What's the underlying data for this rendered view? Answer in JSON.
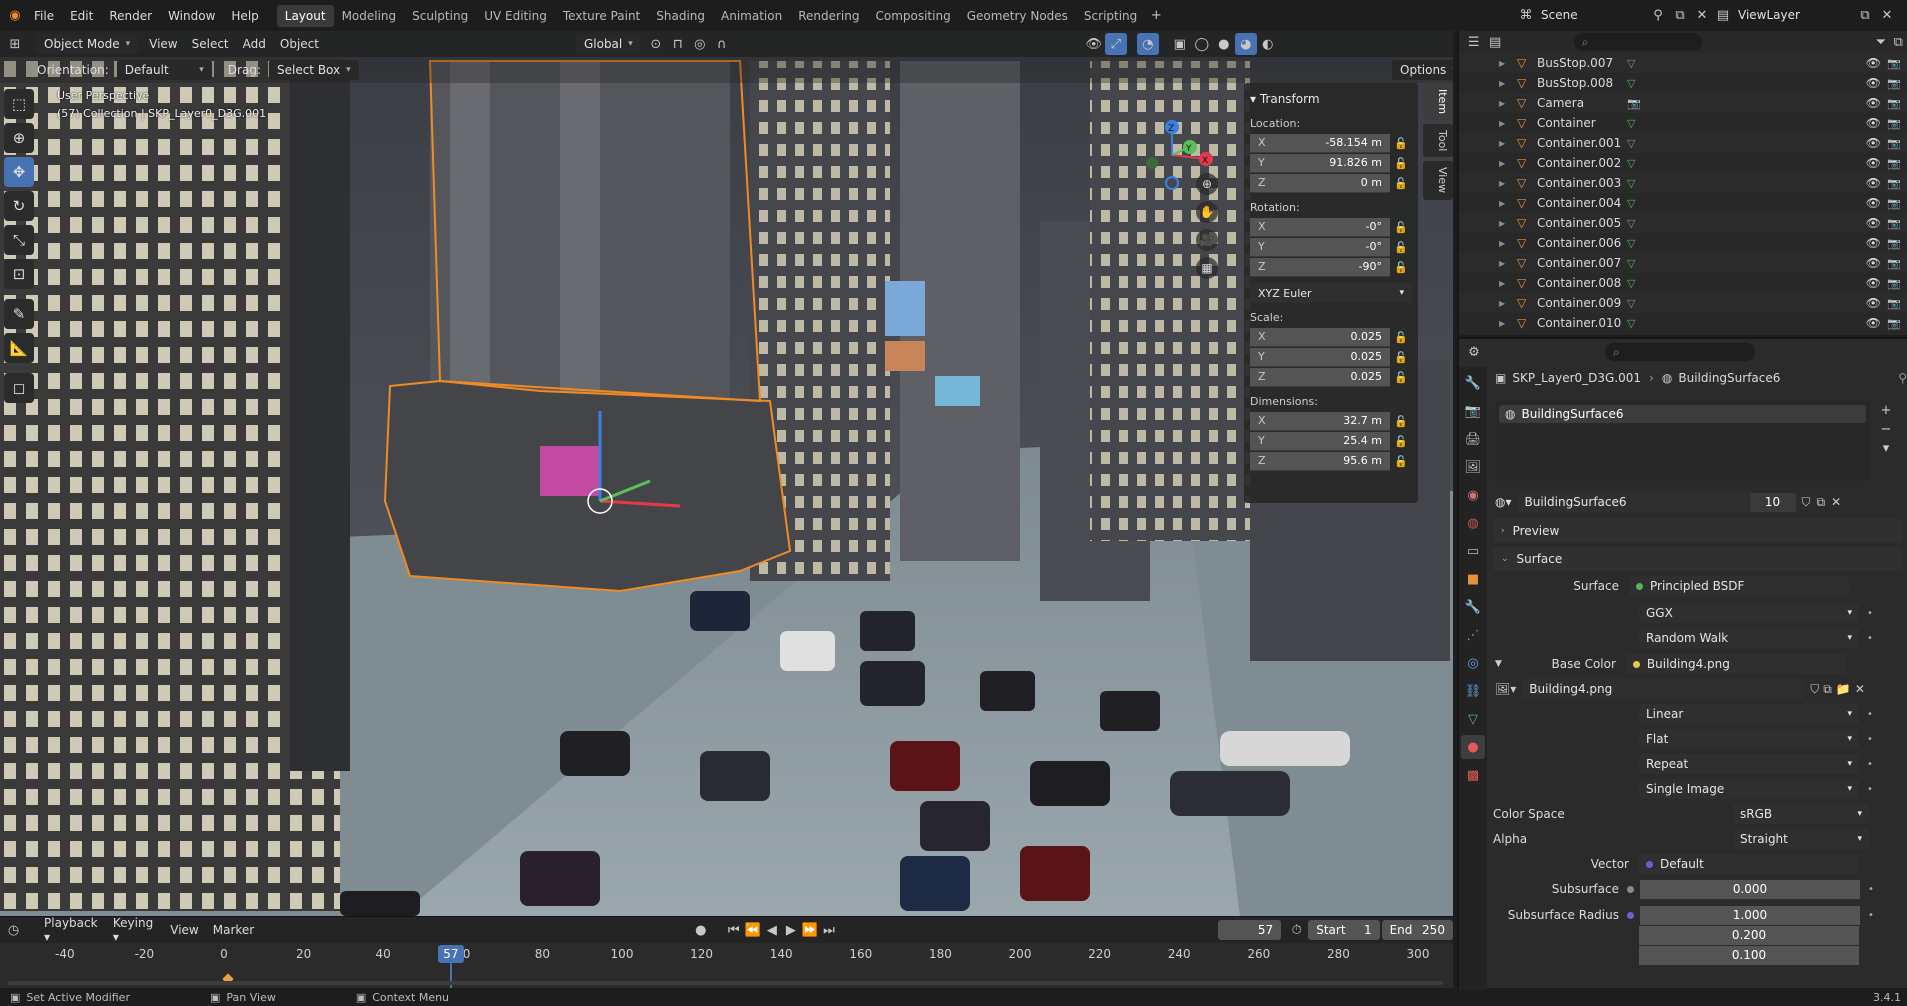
{
  "menu": {
    "file": "File",
    "edit": "Edit",
    "render": "Render",
    "window": "Window",
    "help": "Help"
  },
  "workspaces": [
    "Layout",
    "Modeling",
    "Sculpting",
    "UV Editing",
    "Texture Paint",
    "Shading",
    "Animation",
    "Rendering",
    "Compositing",
    "Geometry Nodes",
    "Scripting"
  ],
  "workspace_add": "+",
  "scene": {
    "label": "Scene",
    "view_layer": "ViewLayer"
  },
  "viewport": {
    "mode": "Object Mode",
    "menus": [
      "View",
      "Select",
      "Add",
      "Object"
    ],
    "transform_orientation": "Global",
    "orientation_label": "Orientation:",
    "orientation_value": "Default",
    "drag_label": "Drag:",
    "drag_value": "Select Box",
    "options_label": "Options",
    "overlay_line1": "User Perspective",
    "overlay_line2": "(57) Collection | SKP_Layer0_D3G.001"
  },
  "npanel": {
    "tabs": [
      "Item",
      "Tool",
      "View"
    ],
    "header": "Transform",
    "location_label": "Location:",
    "location": [
      {
        "axis": "X",
        "value": "-58.154 m"
      },
      {
        "axis": "Y",
        "value": "91.826 m"
      },
      {
        "axis": "Z",
        "value": "0 m"
      }
    ],
    "rotation_label": "Rotation:",
    "rotation": [
      {
        "axis": "X",
        "value": "-0°"
      },
      {
        "axis": "Y",
        "value": "-0°"
      },
      {
        "axis": "Z",
        "value": "-90°"
      }
    ],
    "rotation_mode": "XYZ Euler",
    "scale_label": "Scale:",
    "scale": [
      {
        "axis": "X",
        "value": "0.025"
      },
      {
        "axis": "Y",
        "value": "0.025"
      },
      {
        "axis": "Z",
        "value": "0.025"
      }
    ],
    "dimensions_label": "Dimensions:",
    "dimensions": [
      {
        "axis": "X",
        "value": "32.7 m"
      },
      {
        "axis": "Y",
        "value": "25.4 m"
      },
      {
        "axis": "Z",
        "value": "95.6 m"
      }
    ]
  },
  "gizmo": {
    "x": "X",
    "y": "Y",
    "z": "Z"
  },
  "timeline": {
    "menus": [
      "Playback",
      "Keying",
      "View",
      "Marker"
    ],
    "current_frame": "57",
    "start_label": "Start",
    "start": "1",
    "end_label": "End",
    "end": "250",
    "ticks": [
      "-40",
      "-20",
      "0",
      "20",
      "40",
      "60",
      "80",
      "100",
      "120",
      "140",
      "160",
      "180",
      "200",
      "220",
      "240",
      "260",
      "280",
      "300"
    ],
    "indicator": "57"
  },
  "statusbar": {
    "items": [
      "Set Active Modifier",
      "Pan View",
      "Context Menu"
    ],
    "version": "3.4.1"
  },
  "outliner": {
    "rows": [
      {
        "name": "BusStop.007",
        "kind": "mesh"
      },
      {
        "name": "BusStop.008",
        "kind": "mesh"
      },
      {
        "name": "Camera",
        "kind": "camera"
      },
      {
        "name": "Container",
        "kind": "mesh"
      },
      {
        "name": "Container.001",
        "kind": "mesh"
      },
      {
        "name": "Container.002",
        "kind": "mesh"
      },
      {
        "name": "Container.003",
        "kind": "mesh"
      },
      {
        "name": "Container.004",
        "kind": "mesh"
      },
      {
        "name": "Container.005",
        "kind": "mesh"
      },
      {
        "name": "Container.006",
        "kind": "mesh"
      },
      {
        "name": "Container.007",
        "kind": "mesh"
      },
      {
        "name": "Container.008",
        "kind": "mesh"
      },
      {
        "name": "Container.009",
        "kind": "mesh"
      },
      {
        "name": "Container.010",
        "kind": "mesh"
      }
    ]
  },
  "properties": {
    "breadcrumb_object": "SKP_Layer0_D3G.001",
    "breadcrumb_material": "BuildingSurface6",
    "slot_name": "BuildingSurface6",
    "material_name": "BuildingSurface6",
    "material_users": "10",
    "preview_label": "Preview",
    "surface_panel": "Surface",
    "surface_label": "Surface",
    "surface_value": "Principled BSDF",
    "distribution": "GGX",
    "subsurface_method": "Random Walk",
    "base_color_label": "Base Color",
    "base_color_value": "Building4.png",
    "image_name": "Building4.png",
    "interpolation": "Linear",
    "projection": "Flat",
    "extension": "Repeat",
    "source": "Single Image",
    "color_space_label": "Color Space",
    "color_space": "sRGB",
    "alpha_label": "Alpha",
    "alpha": "Straight",
    "vector_label": "Vector",
    "vector_value": "Default",
    "subsurface_label": "Subsurface",
    "subsurface_value": "0.000",
    "subsurface_radius_label": "Subsurface Radius",
    "subsurface_radius": [
      "1.000",
      "0.200",
      "0.100"
    ]
  },
  "colors": {
    "accent": "#4772b3",
    "selected_outline": "#f08a24",
    "object_icon": "#e3943a",
    "mesh_icon": "#5ab35a"
  }
}
